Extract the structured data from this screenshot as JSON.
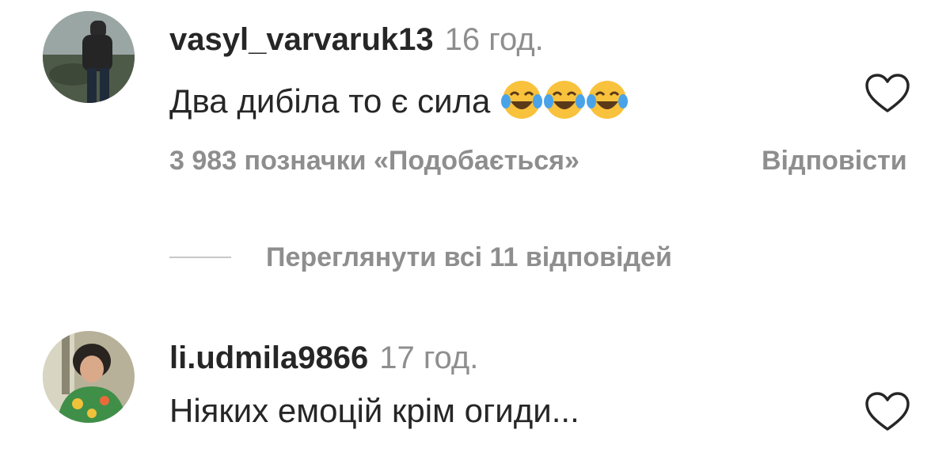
{
  "comments": [
    {
      "username": "vasyl_varvaruk13",
      "time": "16 год.",
      "text": "Два дибіла то є сила",
      "emoji": [
        "laughing-tears-icon",
        "laughing-tears-icon",
        "laughing-tears-icon"
      ],
      "likes": "3 983 позначки «Подобається»",
      "reply": "Відповісти"
    },
    {
      "username": "li.udmila9866",
      "time": "17 год.",
      "text": "Ніяких емоцій крім огиди..."
    }
  ],
  "view_replies": "Переглянути всі 11 відповідей",
  "colors": {
    "text": "#262626",
    "secondary": "#8e8e8e",
    "divider": "#c7c7c7"
  }
}
